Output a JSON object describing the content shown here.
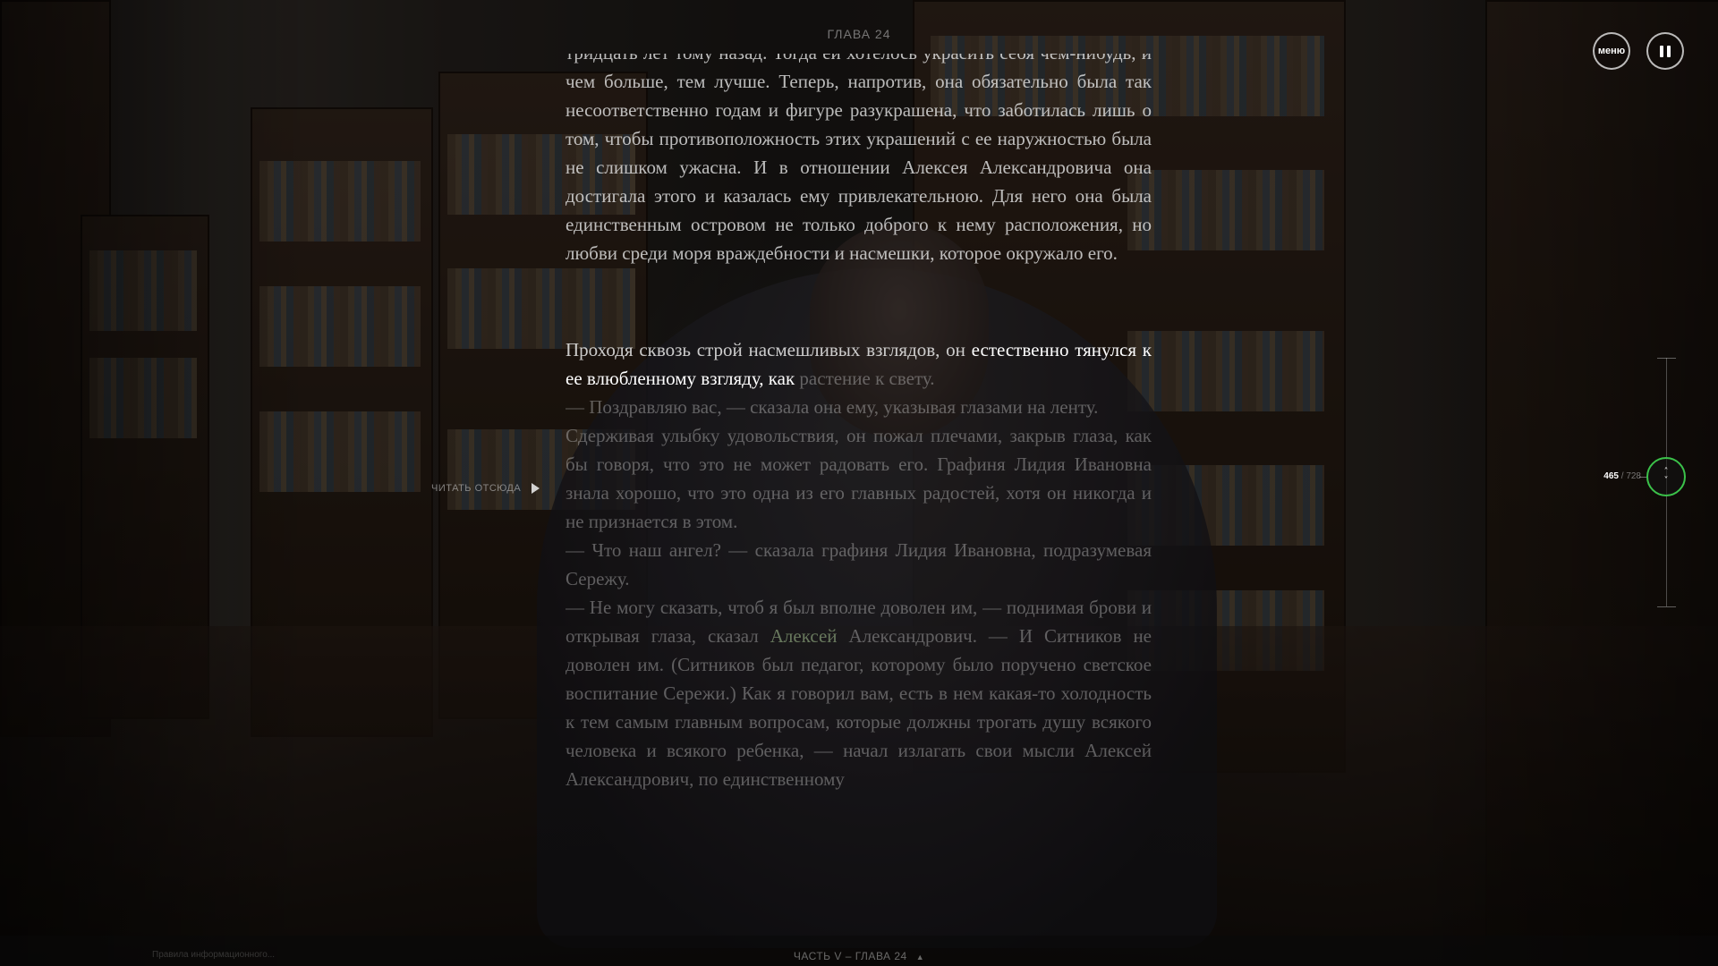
{
  "header": {
    "chapter_title": "ГЛАВА 24",
    "menu_label": "меню",
    "pause_icon": "pause-icon"
  },
  "reader": {
    "past_text": "тридцать лет тому назад. Тогда ей хотелось украсить себя чем-нибудь, и чем больше, тем лучше. Теперь, напротив, она обязательно была так несоответственно годам и фигуре разукрашена, что заботилась лишь о том, чтобы противоположность этих украшений с ее наружностью была не слишком ужасна. И в отношении Алексея Александровича она достигала этого и казалась ему привлекательною. Для него она была единственным островом не только доброго к нему расположения, но любви среди моря враждебности и насмешки, которое окружало его.",
    "current_lead": "Проходя сквозь строй насмешливых взглядов, он ",
    "current_highlight": "естественно тянулся к ее влюбленному взгляду, как",
    "current_tail": " растение к свету.",
    "future_1": "— Поздравляю вас, — сказала она ему, указывая глазами на ленту.",
    "future_2": "Сдерживая улыбку удовольствия, он пожал плечами, закрыв глаза, как бы говоря, что это не может радовать его. Графиня Лидия Ивановна знала хорошо, что это одна из его главных радостей, хотя он никогда и не признается в этом.",
    "future_3": "— Что наш ангел? — сказала графиня Лидия Ивановна, подразумевая Сережу.",
    "future_4a": "— Не могу сказать, чтоб я был вполне доволен им, — поднимая брови и открывая глаза, сказал ",
    "future_4_name": "Алексей",
    "future_4b": " Александрович. — И Ситников не доволен им. (Ситников был педагог, которому было поручено светское воспитание Сережи.) Как я говорил вам, есть в нем какая-то холодность к тем самым главным вопросам, которые должны трогать душу всякого человека и всякого ребенка, — начал излагать свои мысли Алексей Александрович, по единственному"
  },
  "read_from": {
    "label": "ЧИТАТЬ ОТСЮДА",
    "icon": "play-icon"
  },
  "progress": {
    "current": "465",
    "separator": " / ",
    "total": "728",
    "fraction": 0.639,
    "accent_color": "#3bc24a",
    "handle_icon": "chevron-up-down-icon"
  },
  "footer": {
    "left_text": "Правила информационного...",
    "center_text": "ЧАСТЬ V – ГЛАВА 24",
    "caret_icon": "chevron-up-icon"
  }
}
